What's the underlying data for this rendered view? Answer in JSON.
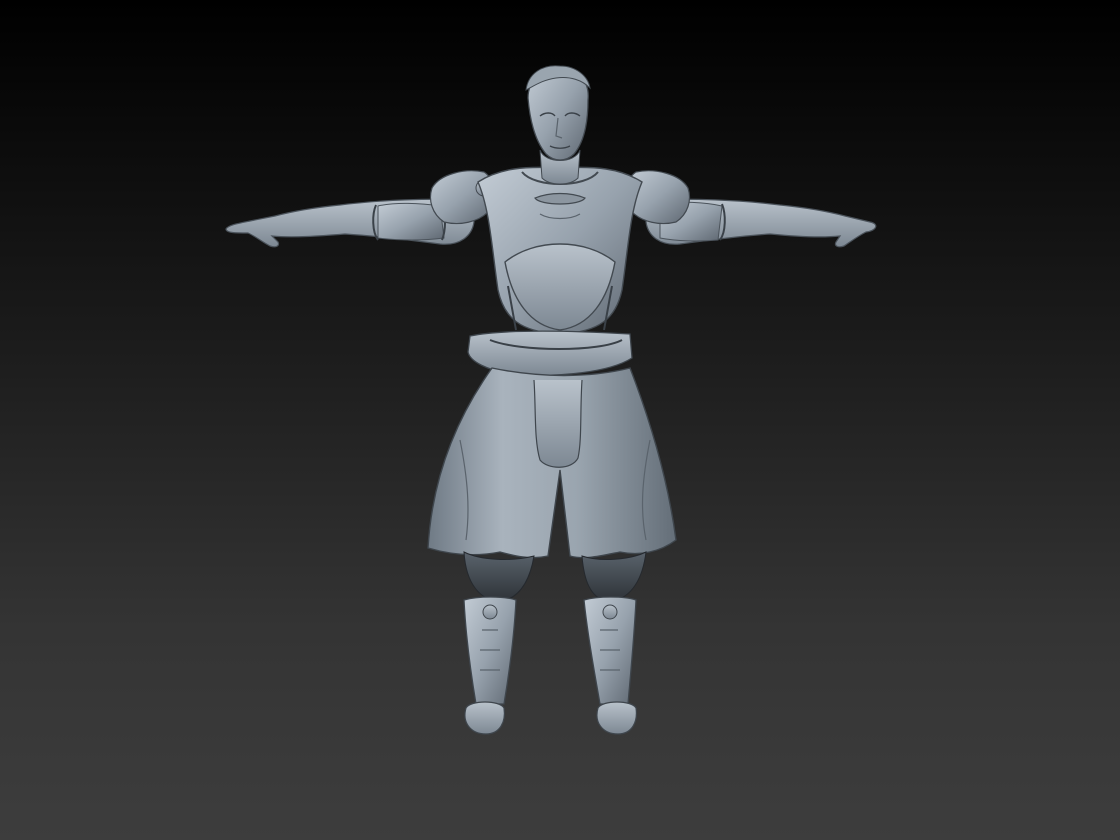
{
  "scene": {
    "subject": "t-pose-armored-figure",
    "colors": {
      "background_top": "#000000",
      "background_bottom": "#3d3d3d",
      "clay_light": "#b7c0c9",
      "clay_mid": "#8d98a3",
      "clay_dark": "#4f5760",
      "clay_shadow": "#2a2f35"
    }
  }
}
